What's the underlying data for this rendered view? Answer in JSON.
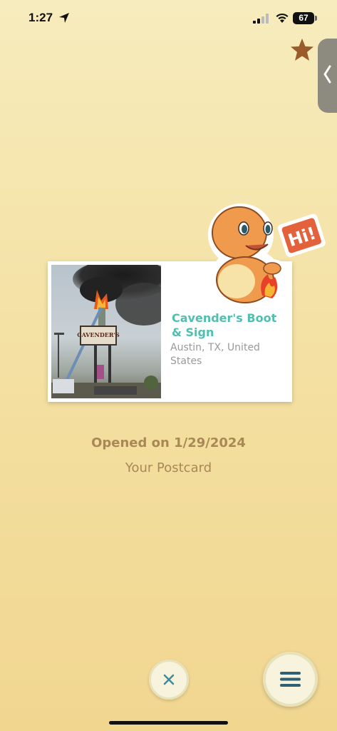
{
  "status_bar": {
    "time": "1:27",
    "battery": "67"
  },
  "card": {
    "name": "Cavender's Boot & Sign",
    "location": "Austin, TX, United States",
    "photo_sign_text": "CAVENDER'S"
  },
  "postcard": {
    "opened_text": "Opened on 1/29/2024",
    "subtitle": "Your Postcard"
  },
  "mascot": {
    "speech_text": "Hi!"
  },
  "colors": {
    "accent_teal": "#4fbfb0",
    "text_brown": "#a98756",
    "star_brown": "#9a5a2a"
  }
}
